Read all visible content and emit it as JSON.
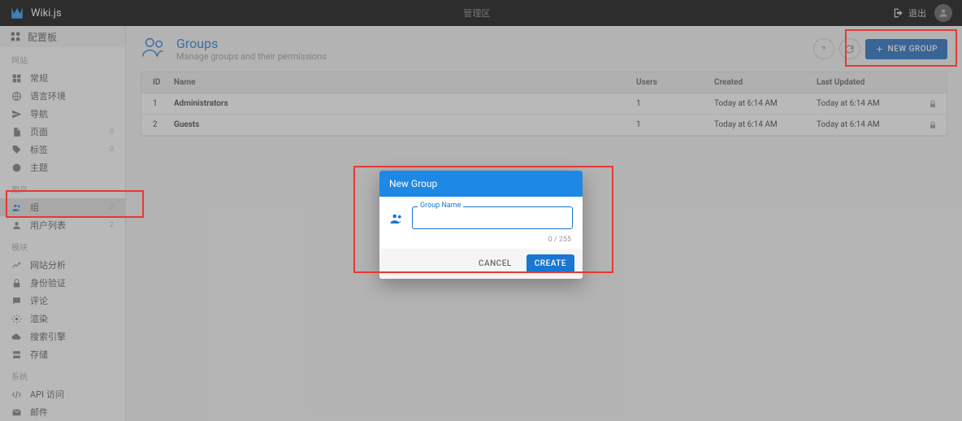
{
  "header": {
    "brand": "Wiki.js",
    "center": "管理区",
    "exit": "退出"
  },
  "sidebar": {
    "top": "配置板",
    "sections": {
      "site": {
        "label": "网站",
        "items": [
          {
            "label": "常规"
          },
          {
            "label": "语言环境"
          },
          {
            "label": "导航"
          },
          {
            "label": "页面",
            "badge": "0"
          },
          {
            "label": "标签",
            "badge": "0"
          },
          {
            "label": "主题"
          }
        ]
      },
      "users": {
        "label": "用户",
        "items": [
          {
            "label": "组",
            "badge": "2"
          },
          {
            "label": "用户列表",
            "badge": "2"
          }
        ]
      },
      "modules": {
        "label": "模块",
        "items": [
          {
            "label": "网站分析"
          },
          {
            "label": "身份验证"
          },
          {
            "label": "评论"
          },
          {
            "label": "渲染"
          },
          {
            "label": "搜索引擎"
          },
          {
            "label": "存储"
          }
        ]
      },
      "system": {
        "label": "系统",
        "items": [
          {
            "label": "API 访问"
          },
          {
            "label": "邮件"
          }
        ]
      }
    }
  },
  "page": {
    "title": "Groups",
    "subtitle": "Manage groups and their permissions",
    "new_group": "NEW GROUP"
  },
  "table": {
    "headers": {
      "id": "ID",
      "name": "Name",
      "users": "Users",
      "created": "Created",
      "updated": "Last Updated"
    },
    "rows": [
      {
        "id": "1",
        "name": "Administrators",
        "users": "1",
        "created": "Today at 6:14 AM",
        "updated": "Today at 6:14 AM"
      },
      {
        "id": "2",
        "name": "Guests",
        "users": "1",
        "created": "Today at 6:14 AM",
        "updated": "Today at 6:14 AM"
      }
    ]
  },
  "dialog": {
    "title": "New Group",
    "field_label": "Group Name",
    "counter": "0 / 255",
    "cancel": "CANCEL",
    "create": "CREATE"
  }
}
